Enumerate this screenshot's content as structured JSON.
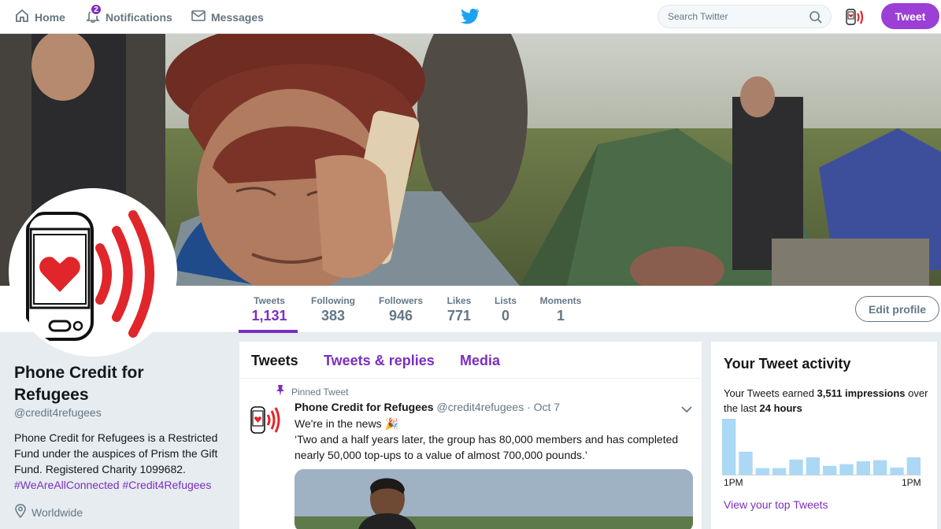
{
  "nav": {
    "home": "Home",
    "notifications": "Notifications",
    "notifications_badge": "2",
    "messages": "Messages",
    "search_placeholder": "Search Twitter",
    "tweet_button": "Tweet"
  },
  "stats": [
    {
      "label": "Tweets",
      "value": "1,131"
    },
    {
      "label": "Following",
      "value": "383"
    },
    {
      "label": "Followers",
      "value": "946"
    },
    {
      "label": "Likes",
      "value": "771"
    },
    {
      "label": "Lists",
      "value": "0"
    },
    {
      "label": "Moments",
      "value": "1"
    }
  ],
  "edit_profile": "Edit profile",
  "profile": {
    "name": "Phone Credit for Refugees",
    "handle": "@credit4refugees",
    "bio": "Phone Credit for Refugees is a Restricted Fund under the auspices of Prism the Gift Fund. Registered Charity 1099682.",
    "bio_tags": "#WeAreAllConnected #Credit4Refugees",
    "location": "Worldwide"
  },
  "timeline": {
    "tabs": [
      "Tweets",
      "Tweets & replies",
      "Media"
    ],
    "pinned_label": "Pinned Tweet",
    "tweet": {
      "name": "Phone Credit for Refugees",
      "meta": "@credit4refugees · Oct 7",
      "line1": "We're in the news 🎉",
      "line2": "‘Two and a half years later, the group has 80,000 members and has completed nearly 50,000 top-ups to a value of almost 700,000 pounds.’"
    }
  },
  "activity": {
    "title": "Your Tweet activity",
    "text_pre": "Your Tweets earned ",
    "impressions": "3,511 impressions",
    "text_mid": " over the last ",
    "period": "24 hours",
    "x_start": "1PM",
    "x_end": "1PM",
    "link": "View your top Tweets",
    "bar_color": "#aad8f5",
    "bars": [
      1.0,
      0.42,
      0.13,
      0.13,
      0.28,
      0.32,
      0.17,
      0.2,
      0.25,
      0.27,
      0.14,
      0.32
    ]
  },
  "colors": {
    "accent": "#7b2fbf",
    "brand_red": "#e0262a",
    "twitter_blue": "#1da1f2"
  }
}
